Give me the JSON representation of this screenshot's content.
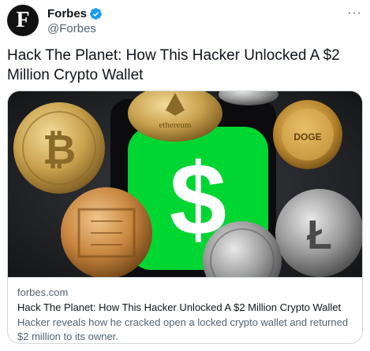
{
  "author": {
    "avatar_letter": "F",
    "display_name": "Forbes",
    "handle": "@Forbes",
    "verified": true,
    "verified_color": "#1d9bf0"
  },
  "tweet": {
    "text": "Hack The Planet: How This Hacker Unlocked A $2 Million Crypto Wallet"
  },
  "card": {
    "domain": "forbes.com",
    "title": "Hack The Planet: How This Hacker Unlocked A $2 Million Crypto Wallet",
    "description": "Hacker reveals how he cracked open a locked crypto wallet and returned $2 million to its owner.",
    "image_subject": "Crypto coins around a phone showing the Cash App logo",
    "logo_color": "#00d632"
  },
  "icons": {
    "more": "more-horizontal-icon",
    "verified": "verified-badge-icon"
  }
}
